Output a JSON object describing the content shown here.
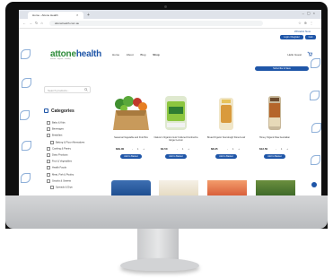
{
  "browser": {
    "tab_title": "Home - Attone Health",
    "url": "attonehealth.com.au",
    "bookmark_link": "Whitelist Now"
  },
  "site": {
    "logo_main": "attone",
    "logo_accent": "health",
    "logo_tagline": "natural · organic · healthy",
    "nav": [
      "Home",
      "About",
      "Blog",
      "Shop"
    ],
    "account": "Hello Guest",
    "top_buttons": [
      "Login / Register",
      "Cart"
    ],
    "promo": "Subscribe & Save"
  },
  "sidebar": {
    "search_placeholder": "Search products...",
    "categories_title": "Categories",
    "categories": [
      "Baby & Kids",
      "Beverages",
      "Breakfast",
      "Baking & Flour Alternatives",
      "Cooking & Pantry",
      "Dairy Products",
      "Fruit & Vegetables",
      "Health Foods",
      "Meat, Fish & Poultry",
      "Snacks & Sweets",
      "Spreads & Dips"
    ]
  },
  "products": [
    {
      "name": "Seasonal Vegetable and Fruit Box",
      "price": "$39.00",
      "qty": "- 1 +",
      "cta": "Add to Basket"
    },
    {
      "name": "Nature's Organics Gutz Cultured Kombucha Ginger Lemon",
      "price": "$4.50",
      "qty": "- 1 +",
      "cta": "Add to Basket"
    },
    {
      "name": "Bread Organic Sourdough Sliced Loaf",
      "price": "$8.95",
      "qty": "- 1 +",
      "cta": "Add to Basket"
    },
    {
      "name": "Honey Organic Raw Australian",
      "price": "$12.50",
      "qty": "- 1 +",
      "cta": "Add to Basket"
    }
  ],
  "colors": {
    "brand_blue": "#1f56a8",
    "brand_green": "#2e8b3a",
    "pattern": "#8fb0d9"
  }
}
